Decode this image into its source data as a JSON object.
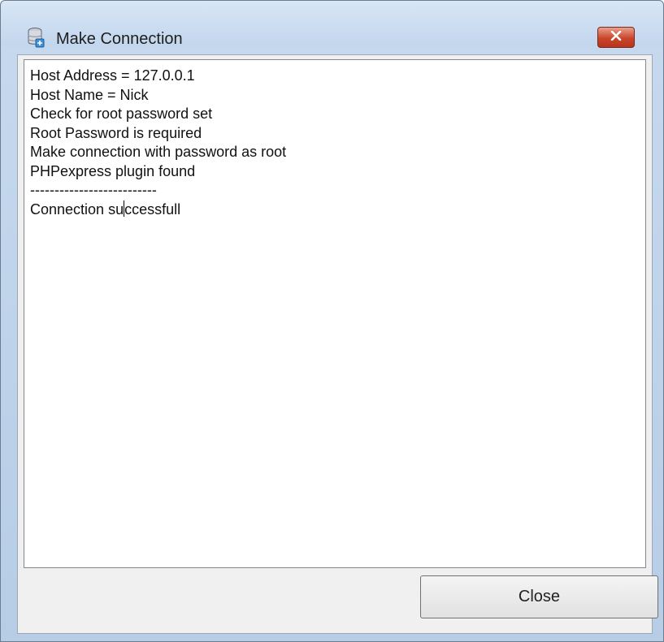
{
  "window": {
    "title": "Make Connection",
    "title_icon": "database-connection-icon",
    "close_icon": "close-icon"
  },
  "log": {
    "lines": [
      "Host Address = 127.0.0.1",
      "Host Name = Nick",
      "Check for root password set",
      "Root Password is required",
      "Make connection with password as root",
      "PHPexpress plugin found",
      "--------------------------",
      "Connection successfull"
    ]
  },
  "footer": {
    "close_label": "Close"
  },
  "colors": {
    "close_x_red": "#c9452a",
    "titlebar": "#c2d6ed"
  }
}
